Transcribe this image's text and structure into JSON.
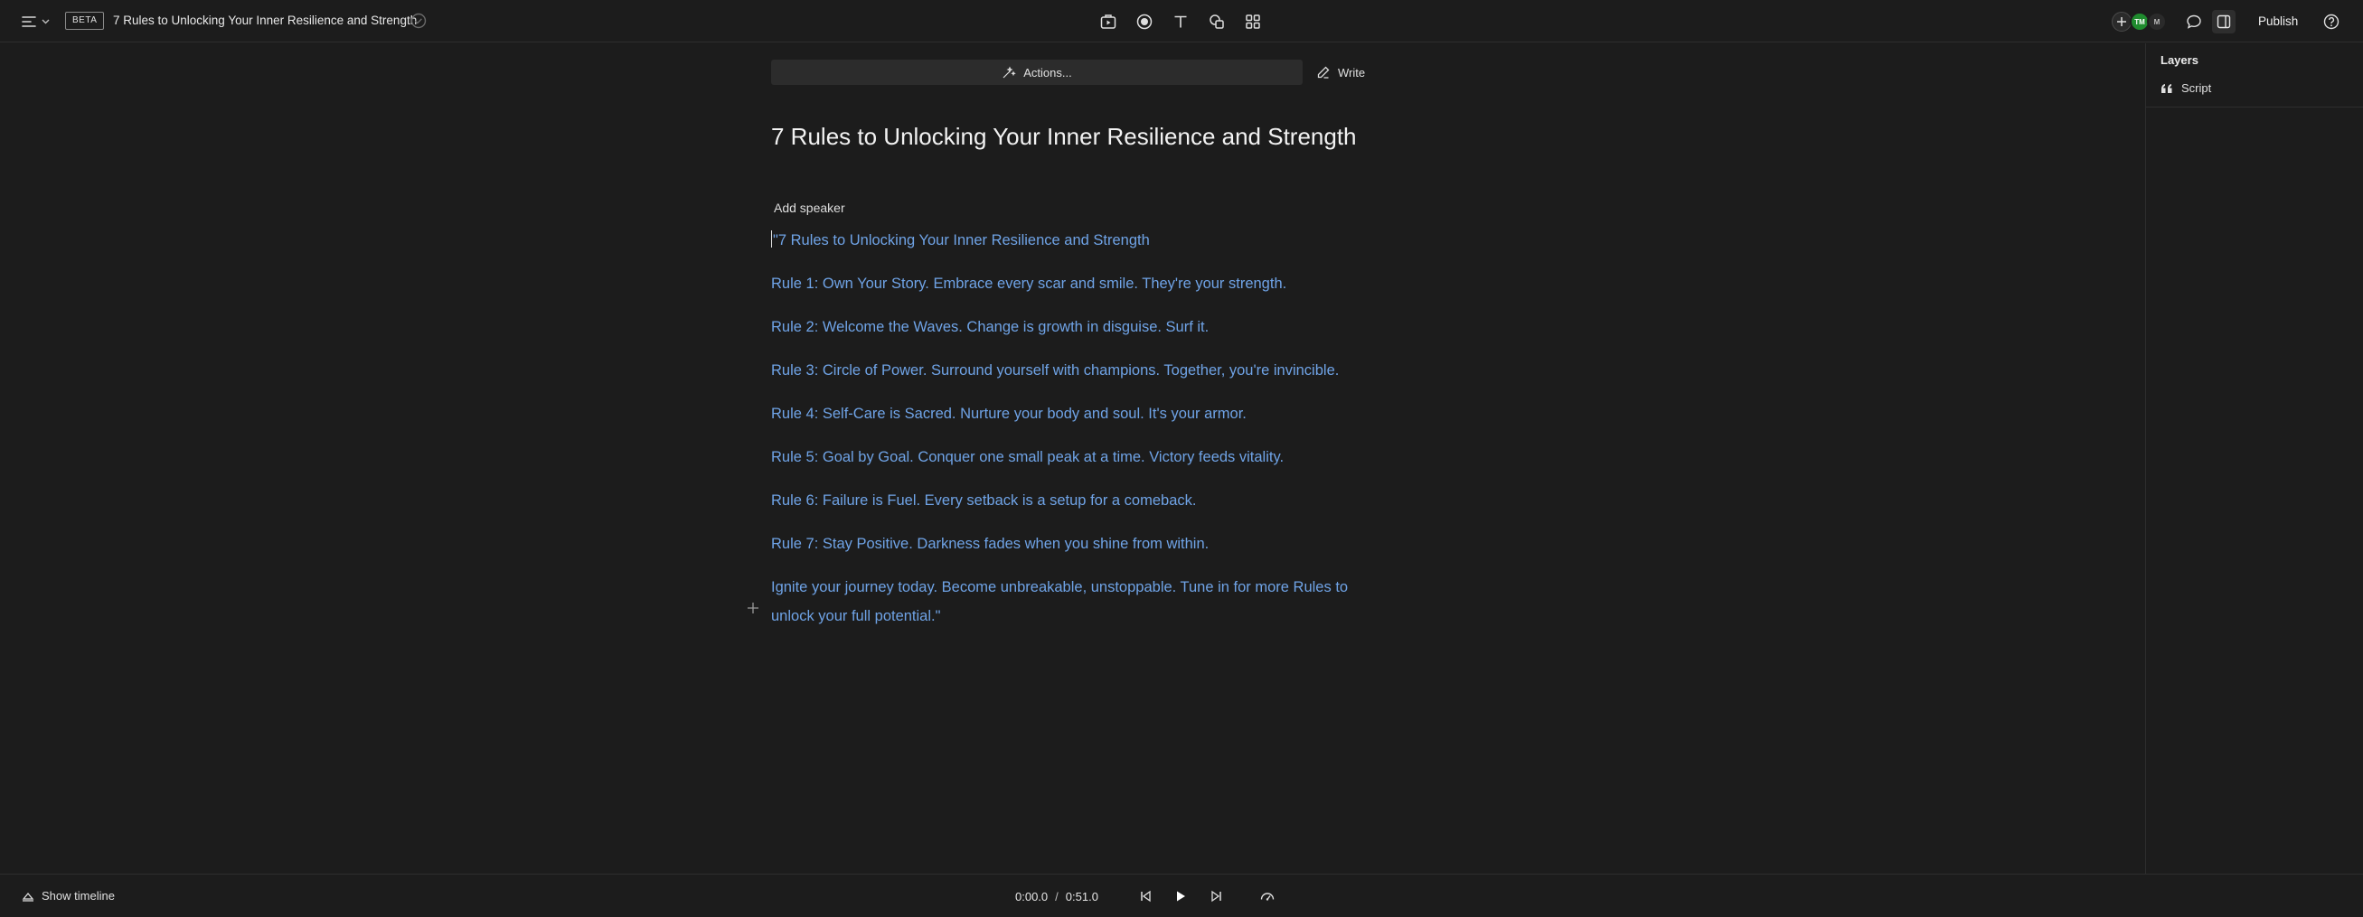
{
  "header": {
    "badge": "BETA",
    "document_title": "7 Rules to Unlocking Your Inner Resilience and Strength",
    "publish_label": "Publish",
    "avatars": [
      {
        "initials": "TM",
        "color": "#1f8b2e"
      },
      {
        "initials": "M",
        "color": "#2a2a2a"
      }
    ],
    "tools": [
      "media-icon",
      "record-icon",
      "text-icon",
      "shapes-icon",
      "grid-icon"
    ]
  },
  "editor": {
    "actions_label": "Actions...",
    "write_label": "Write",
    "title": "7 Rules to Unlocking Your Inner Resilience and Strength",
    "add_speaker_label": "Add speaker",
    "paragraphs": [
      "\"7 Rules to Unlocking Your Inner Resilience and Strength",
      "Rule 1: Own Your Story. Embrace every scar and smile. They're your strength.",
      "Rule 2: Welcome the Waves. Change is growth in disguise. Surf it.",
      "Rule 3: Circle of Power. Surround yourself with champions. Together, you're invincible.",
      "Rule 4: Self-Care is Sacred. Nurture your body and soul. It's your armor.",
      "Rule 5: Goal by Goal. Conquer one small peak at a time. Victory feeds vitality.",
      "Rule 6: Failure is Fuel. Every setback is a setup for a comeback.",
      "Rule 7: Stay Positive. Darkness fades when you shine from within.",
      "Ignite your journey today. Become unbreakable, unstoppable. Tune in for more Rules to unlock your full potential.\""
    ],
    "text_color": "#6fa3e6"
  },
  "layers": {
    "title": "Layers",
    "items": [
      {
        "label": "Script",
        "icon": "quote-icon"
      }
    ]
  },
  "footer": {
    "show_timeline_label": "Show timeline",
    "current_time": "0:00.0",
    "separator": "/",
    "total_time": "0:51.0"
  }
}
